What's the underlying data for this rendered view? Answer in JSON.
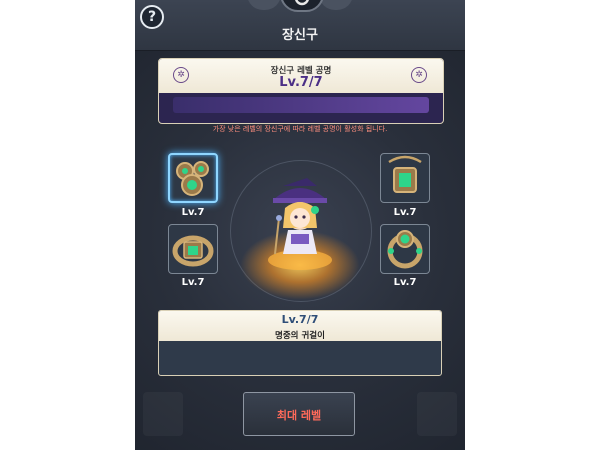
{
  "header": {
    "title": "장신구",
    "help_label": "?"
  },
  "resonance": {
    "subtitle": "장신구 레벨 공명",
    "level": "Lv.7/7",
    "notice": "가장 낮은 레벨의 장신구에 따라 레벨 공명이 활성화 됩니다."
  },
  "slots": [
    {
      "name": "earring",
      "level": "Lv.7",
      "selected": true
    },
    {
      "name": "necklace",
      "level": "Lv.7",
      "selected": false
    },
    {
      "name": "bracelet",
      "level": "Lv.7",
      "selected": false
    },
    {
      "name": "ring",
      "level": "Lv.7",
      "selected": false
    }
  ],
  "detail": {
    "level": "Lv.7/7",
    "item_name": "명중의 귀걸이"
  },
  "action": {
    "max_label": "최대 레벨"
  },
  "colors": {
    "gem": "#2fd48a",
    "gold": "#c8a56a",
    "accent_red": "#ff6a5a",
    "selected_glow": "#4fb6ff"
  }
}
